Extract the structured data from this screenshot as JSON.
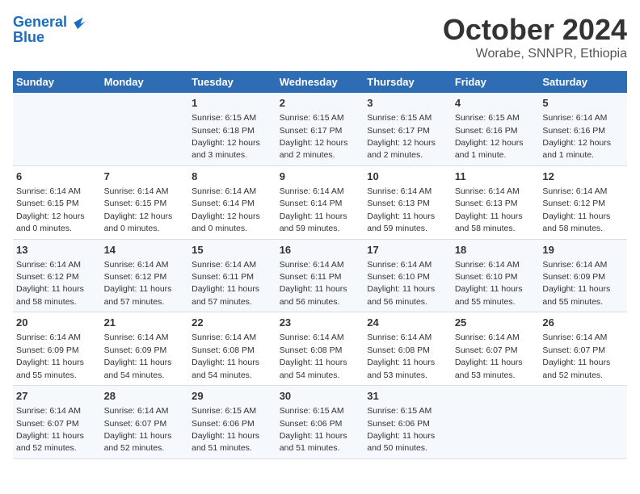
{
  "header": {
    "logo_general": "General",
    "logo_blue": "Blue",
    "main_title": "October 2024",
    "subtitle": "Worabe, SNNPR, Ethiopia"
  },
  "days_of_week": [
    "Sunday",
    "Monday",
    "Tuesday",
    "Wednesday",
    "Thursday",
    "Friday",
    "Saturday"
  ],
  "weeks": [
    [
      {
        "day": "",
        "info": ""
      },
      {
        "day": "",
        "info": ""
      },
      {
        "day": "1",
        "sunrise": "Sunrise: 6:15 AM",
        "sunset": "Sunset: 6:18 PM",
        "daylight": "Daylight: 12 hours and 3 minutes."
      },
      {
        "day": "2",
        "sunrise": "Sunrise: 6:15 AM",
        "sunset": "Sunset: 6:17 PM",
        "daylight": "Daylight: 12 hours and 2 minutes."
      },
      {
        "day": "3",
        "sunrise": "Sunrise: 6:15 AM",
        "sunset": "Sunset: 6:17 PM",
        "daylight": "Daylight: 12 hours and 2 minutes."
      },
      {
        "day": "4",
        "sunrise": "Sunrise: 6:15 AM",
        "sunset": "Sunset: 6:16 PM",
        "daylight": "Daylight: 12 hours and 1 minute."
      },
      {
        "day": "5",
        "sunrise": "Sunrise: 6:14 AM",
        "sunset": "Sunset: 6:16 PM",
        "daylight": "Daylight: 12 hours and 1 minute."
      }
    ],
    [
      {
        "day": "6",
        "sunrise": "Sunrise: 6:14 AM",
        "sunset": "Sunset: 6:15 PM",
        "daylight": "Daylight: 12 hours and 0 minutes."
      },
      {
        "day": "7",
        "sunrise": "Sunrise: 6:14 AM",
        "sunset": "Sunset: 6:15 PM",
        "daylight": "Daylight: 12 hours and 0 minutes."
      },
      {
        "day": "8",
        "sunrise": "Sunrise: 6:14 AM",
        "sunset": "Sunset: 6:14 PM",
        "daylight": "Daylight: 12 hours and 0 minutes."
      },
      {
        "day": "9",
        "sunrise": "Sunrise: 6:14 AM",
        "sunset": "Sunset: 6:14 PM",
        "daylight": "Daylight: 11 hours and 59 minutes."
      },
      {
        "day": "10",
        "sunrise": "Sunrise: 6:14 AM",
        "sunset": "Sunset: 6:13 PM",
        "daylight": "Daylight: 11 hours and 59 minutes."
      },
      {
        "day": "11",
        "sunrise": "Sunrise: 6:14 AM",
        "sunset": "Sunset: 6:13 PM",
        "daylight": "Daylight: 11 hours and 58 minutes."
      },
      {
        "day": "12",
        "sunrise": "Sunrise: 6:14 AM",
        "sunset": "Sunset: 6:12 PM",
        "daylight": "Daylight: 11 hours and 58 minutes."
      }
    ],
    [
      {
        "day": "13",
        "sunrise": "Sunrise: 6:14 AM",
        "sunset": "Sunset: 6:12 PM",
        "daylight": "Daylight: 11 hours and 58 minutes."
      },
      {
        "day": "14",
        "sunrise": "Sunrise: 6:14 AM",
        "sunset": "Sunset: 6:12 PM",
        "daylight": "Daylight: 11 hours and 57 minutes."
      },
      {
        "day": "15",
        "sunrise": "Sunrise: 6:14 AM",
        "sunset": "Sunset: 6:11 PM",
        "daylight": "Daylight: 11 hours and 57 minutes."
      },
      {
        "day": "16",
        "sunrise": "Sunrise: 6:14 AM",
        "sunset": "Sunset: 6:11 PM",
        "daylight": "Daylight: 11 hours and 56 minutes."
      },
      {
        "day": "17",
        "sunrise": "Sunrise: 6:14 AM",
        "sunset": "Sunset: 6:10 PM",
        "daylight": "Daylight: 11 hours and 56 minutes."
      },
      {
        "day": "18",
        "sunrise": "Sunrise: 6:14 AM",
        "sunset": "Sunset: 6:10 PM",
        "daylight": "Daylight: 11 hours and 55 minutes."
      },
      {
        "day": "19",
        "sunrise": "Sunrise: 6:14 AM",
        "sunset": "Sunset: 6:09 PM",
        "daylight": "Daylight: 11 hours and 55 minutes."
      }
    ],
    [
      {
        "day": "20",
        "sunrise": "Sunrise: 6:14 AM",
        "sunset": "Sunset: 6:09 PM",
        "daylight": "Daylight: 11 hours and 55 minutes."
      },
      {
        "day": "21",
        "sunrise": "Sunrise: 6:14 AM",
        "sunset": "Sunset: 6:09 PM",
        "daylight": "Daylight: 11 hours and 54 minutes."
      },
      {
        "day": "22",
        "sunrise": "Sunrise: 6:14 AM",
        "sunset": "Sunset: 6:08 PM",
        "daylight": "Daylight: 11 hours and 54 minutes."
      },
      {
        "day": "23",
        "sunrise": "Sunrise: 6:14 AM",
        "sunset": "Sunset: 6:08 PM",
        "daylight": "Daylight: 11 hours and 54 minutes."
      },
      {
        "day": "24",
        "sunrise": "Sunrise: 6:14 AM",
        "sunset": "Sunset: 6:08 PM",
        "daylight": "Daylight: 11 hours and 53 minutes."
      },
      {
        "day": "25",
        "sunrise": "Sunrise: 6:14 AM",
        "sunset": "Sunset: 6:07 PM",
        "daylight": "Daylight: 11 hours and 53 minutes."
      },
      {
        "day": "26",
        "sunrise": "Sunrise: 6:14 AM",
        "sunset": "Sunset: 6:07 PM",
        "daylight": "Daylight: 11 hours and 52 minutes."
      }
    ],
    [
      {
        "day": "27",
        "sunrise": "Sunrise: 6:14 AM",
        "sunset": "Sunset: 6:07 PM",
        "daylight": "Daylight: 11 hours and 52 minutes."
      },
      {
        "day": "28",
        "sunrise": "Sunrise: 6:14 AM",
        "sunset": "Sunset: 6:07 PM",
        "daylight": "Daylight: 11 hours and 52 minutes."
      },
      {
        "day": "29",
        "sunrise": "Sunrise: 6:15 AM",
        "sunset": "Sunset: 6:06 PM",
        "daylight": "Daylight: 11 hours and 51 minutes."
      },
      {
        "day": "30",
        "sunrise": "Sunrise: 6:15 AM",
        "sunset": "Sunset: 6:06 PM",
        "daylight": "Daylight: 11 hours and 51 minutes."
      },
      {
        "day": "31",
        "sunrise": "Sunrise: 6:15 AM",
        "sunset": "Sunset: 6:06 PM",
        "daylight": "Daylight: 11 hours and 50 minutes."
      },
      {
        "day": "",
        "info": ""
      },
      {
        "day": "",
        "info": ""
      }
    ]
  ]
}
